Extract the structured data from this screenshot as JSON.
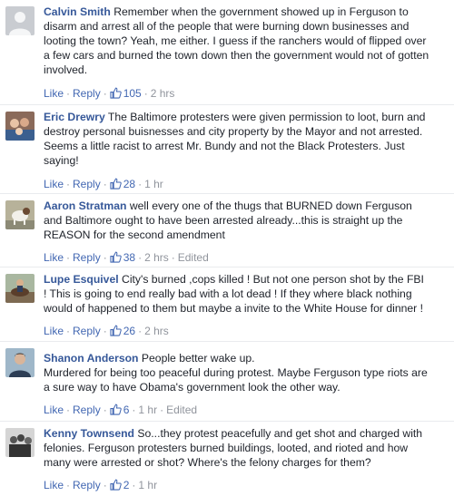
{
  "comments": [
    {
      "author": "Calvin Smith",
      "text": " Remember when the government showed up in Ferguson to\ndisarm and arrest all of the people that were burning down businesses and\nlooting the town? Yeah, me either. I guess if the ranchers would of flipped over\na few cars and burned the town down then the government would not of gotten\ninvolved.",
      "like_label": "Like",
      "reply_label": "Reply",
      "likes": "105",
      "time": "2 hrs",
      "edited": ""
    },
    {
      "author": "Eric Drewry",
      "text": " The Baltimore protesters were given permission to loot, burn and\ndestroy personal buisnesses and city property by the Mayor and not arrested.\nSeems a little racist to arrest Mr. Bundy and not the Black Protesters. Just\nsaying!",
      "like_label": "Like",
      "reply_label": "Reply",
      "likes": "28",
      "time": "1 hr",
      "edited": ""
    },
    {
      "author": "Aaron Stratman",
      "text": " well every one of the thugs that BURNED down Ferguson\nand Baltimore ought to have been arrested already...this is straight up the\nREASON for the second amendment",
      "like_label": "Like",
      "reply_label": "Reply",
      "likes": "38",
      "time": "2 hrs",
      "edited": "Edited"
    },
    {
      "author": "Lupe Esquivel",
      "text": " City's burned ,cops killed ! But not one person shot by the FBI\n! This is going to end really bad with a lot dead ! If they where black nothing\nwould of happened to them but maybe a invite to the White House for dinner !",
      "like_label": "Like",
      "reply_label": "Reply",
      "likes": "26",
      "time": "2 hrs",
      "edited": ""
    },
    {
      "author": "Shanon Anderson",
      "text": " People better wake up.\nMurdered for being too peaceful during protest. Maybe Ferguson type riots are\na sure way to have Obama's government look the other way.",
      "like_label": "Like",
      "reply_label": "Reply",
      "likes": "6",
      "time": "1 hr",
      "edited": "Edited"
    },
    {
      "author": "Kenny Townsend",
      "text": " So...they protest peacefully and get shot and charged with\nfelonies. Ferguson protesters burned buildings, looted, and rioted and how\nmany were arrested or shot? Where's the felony charges for them?",
      "like_label": "Like",
      "reply_label": "Reply",
      "likes": "2",
      "time": "1 hr",
      "edited": ""
    }
  ],
  "icons": {
    "like": "thumbs-up-icon",
    "avatar": "user-avatar"
  },
  "colors": {
    "name": "#365899",
    "link": "#4267b2",
    "meta": "#90949c",
    "text": "#1d2129"
  }
}
